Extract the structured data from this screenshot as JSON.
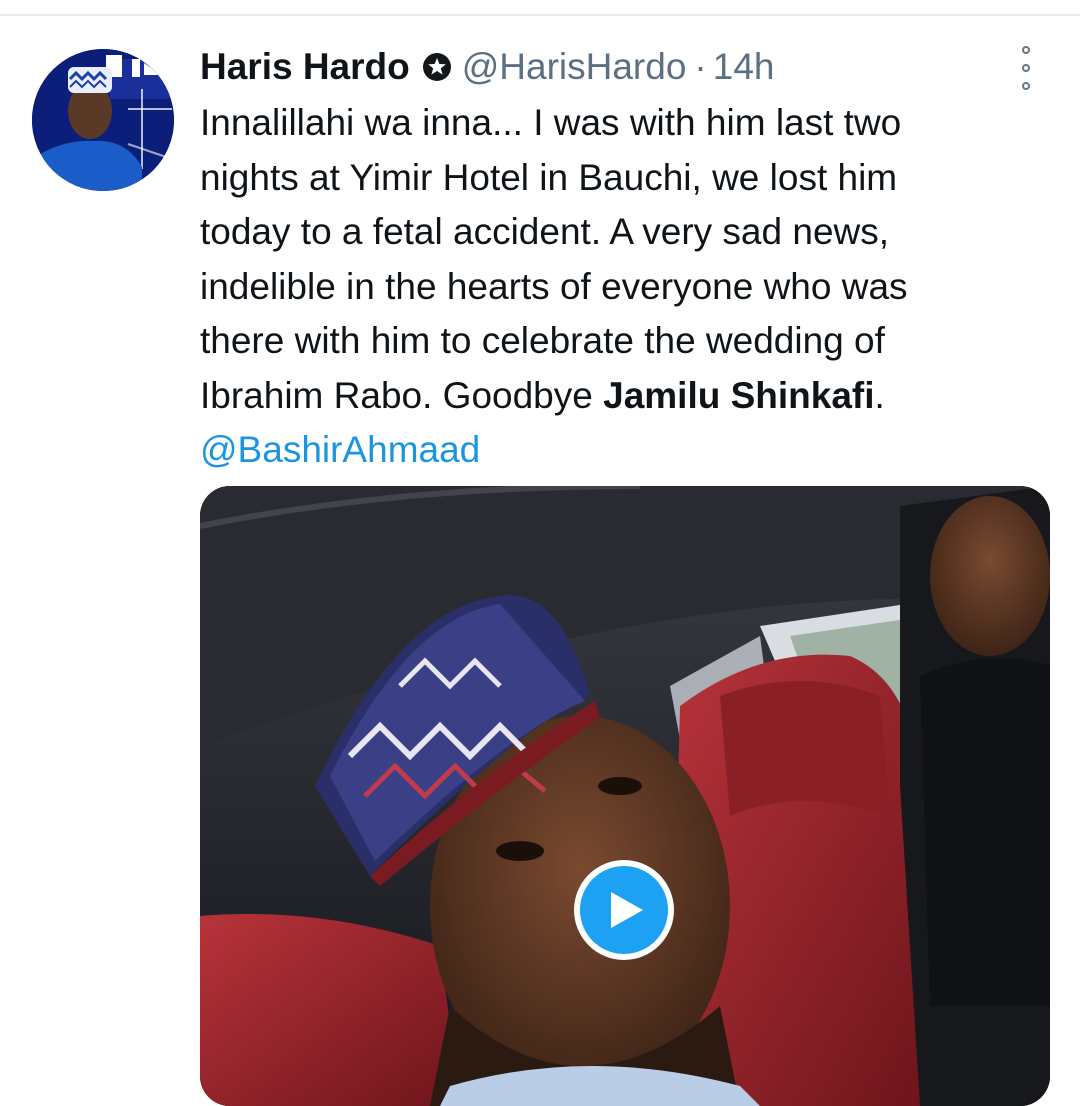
{
  "tweet": {
    "author": {
      "display_name": "Haris Hardo",
      "handle": "@HarisHardo",
      "verified_icon": "verified-badge-icon",
      "avatar_icon": "avatar-photo"
    },
    "separator": "·",
    "time": "14h",
    "more_icon": "more-vertical-icon",
    "text_lines": [
      "Innalillahi wa inna... I was with him last two",
      "nights at Yimir Hotel in Bauchi, we lost him",
      "today to a fetal accident. A very sad news,",
      "indelible in the hearts of everyone who was",
      "there with him to celebrate the wedding of"
    ],
    "last_line_prefix": "Ibrahim Rabo. Goodbye ",
    "last_line_bold": "Jamilu Shinkafi",
    "last_line_suffix": ".",
    "mention": "@BashirAhmaad",
    "media": {
      "type": "video",
      "play_icon": "play-icon"
    },
    "colors": {
      "link": "#1b95e0",
      "secondary_text": "#5b7083",
      "play_button": "#1da1f2"
    }
  }
}
